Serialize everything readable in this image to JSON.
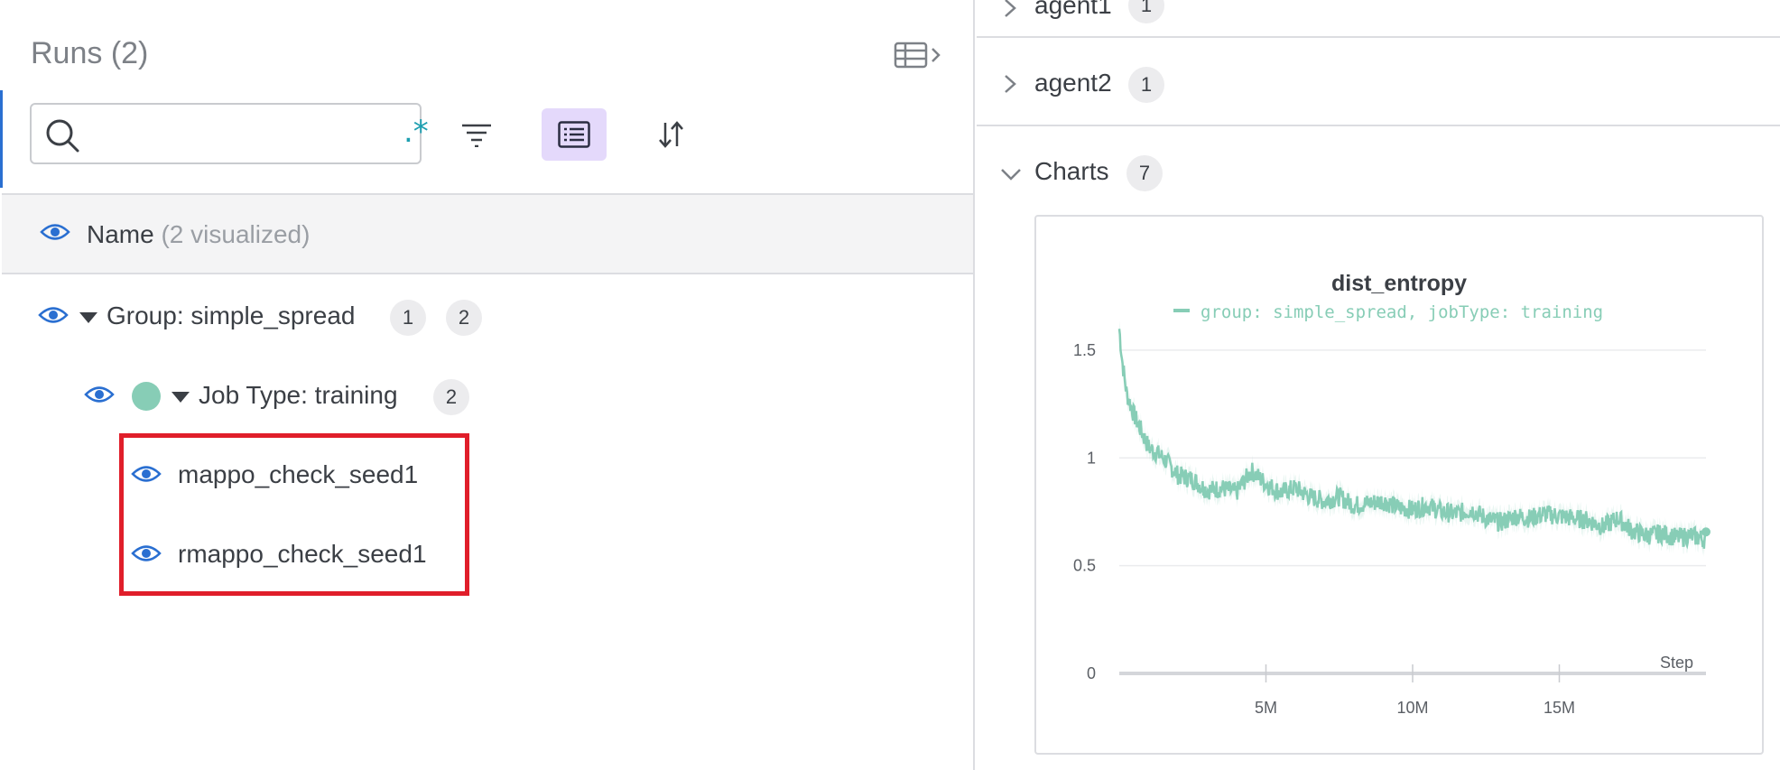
{
  "runs": {
    "title": "Runs (2)",
    "search": {
      "value": "",
      "placeholder": "",
      "regex_label": ".*"
    },
    "name_header": {
      "label": "Name",
      "count": "(2 visualized)"
    },
    "group": {
      "label": "Group: simple_spread",
      "badge1": "1",
      "badge2": "2"
    },
    "job_type": {
      "label": "Job Type: training",
      "badge": "2",
      "color": "#87cdb6"
    },
    "items": [
      {
        "label": "mappo_check_seed1"
      },
      {
        "label": "rmappo_check_seed1"
      }
    ],
    "highlight_color": "#e01e2a",
    "toolbar": {
      "group_active_color": "#e4d9fb"
    }
  },
  "sections": [
    {
      "label": "agent1",
      "count": "1",
      "expanded": false
    },
    {
      "label": "agent2",
      "count": "1",
      "expanded": false
    },
    {
      "label": "Charts",
      "count": "7",
      "expanded": true
    }
  ],
  "chart_data": {
    "type": "line",
    "title": "dist_entropy",
    "legend": "group: simple_spread, jobType: training",
    "legend_placement": "top-center",
    "xlabel": "Step",
    "ylabel": "",
    "xlim": [
      0,
      20000000
    ],
    "ylim": [
      0,
      1.6
    ],
    "x_ticks": [
      5000000,
      10000000,
      15000000
    ],
    "x_tick_labels": [
      "5M",
      "10M",
      "15M"
    ],
    "y_ticks": [
      0,
      0.5,
      1,
      1.5
    ],
    "y_tick_labels": [
      "0",
      "0.5",
      "1",
      "1.5"
    ],
    "grid": true,
    "color": "#87cdb6",
    "series": [
      {
        "x": [
          0,
          100000,
          250000,
          500000,
          1000000,
          1500000,
          2000000,
          2500000,
          3000000,
          3500000,
          4000000,
          4500000,
          5000000,
          5500000,
          6000000,
          6500000,
          7000000,
          7500000,
          8000000,
          8500000,
          9000000,
          9500000,
          10000000,
          10500000,
          11000000,
          11500000,
          12000000,
          12500000,
          13000000,
          13500000,
          14000000,
          14500000,
          15000000,
          15500000,
          16000000,
          16500000,
          17000000,
          17500000,
          18000000,
          18500000,
          19000000,
          19500000,
          20000000
        ],
        "y": [
          1.6,
          1.45,
          1.3,
          1.2,
          1.05,
          1.0,
          0.92,
          0.9,
          0.85,
          0.86,
          0.84,
          0.94,
          0.88,
          0.84,
          0.86,
          0.82,
          0.8,
          0.82,
          0.78,
          0.79,
          0.8,
          0.77,
          0.76,
          0.78,
          0.75,
          0.74,
          0.76,
          0.72,
          0.7,
          0.73,
          0.72,
          0.74,
          0.73,
          0.72,
          0.71,
          0.68,
          0.72,
          0.66,
          0.64,
          0.65,
          0.63,
          0.64,
          0.62
        ]
      }
    ]
  }
}
